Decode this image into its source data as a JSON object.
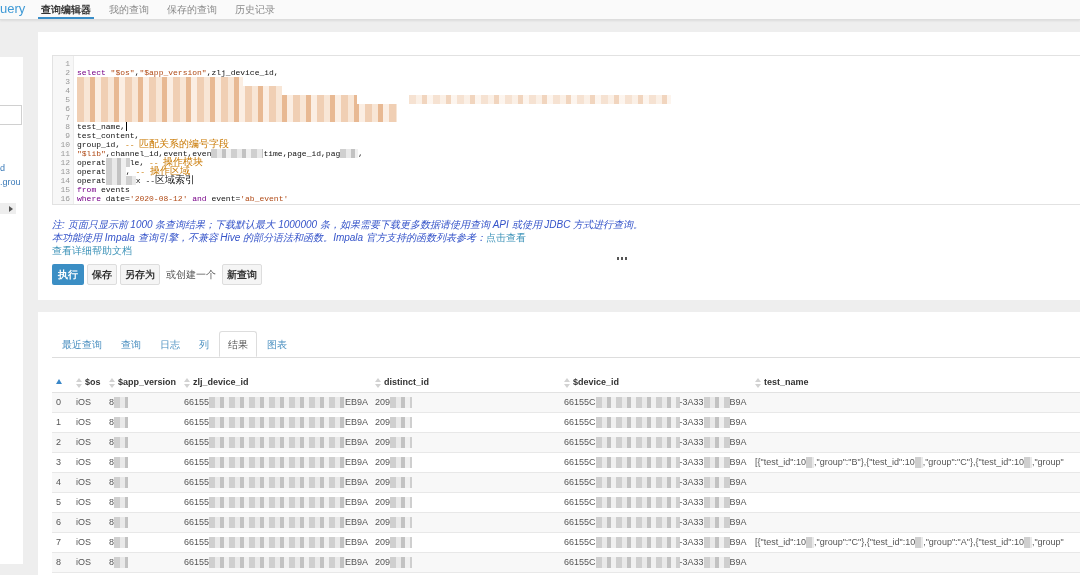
{
  "nav": {
    "logo": "uery",
    "tabs": [
      {
        "label": "查询编辑器",
        "selected": true
      },
      {
        "label": "我的查询",
        "selected": false
      },
      {
        "label": "保存的查询",
        "selected": false
      },
      {
        "label": "历史记录",
        "selected": false
      }
    ]
  },
  "sidebar": {
    "items": [
      {
        "label": "d"
      },
      {
        "label": ".grou"
      }
    ]
  },
  "editor": {
    "lines": [
      {
        "number": "1"
      },
      {
        "number": "2",
        "segments": [
          {
            "kind": "keyword",
            "text": "select"
          },
          {
            "kind": "string",
            "text": " \"$os\""
          },
          {
            "kind": "plain",
            "text": ","
          },
          {
            "kind": "string",
            "text": "\"$app_version\""
          },
          {
            "kind": "plain",
            "text": ",zlj_device_id,"
          }
        ]
      },
      {
        "number": "3",
        "segments": [
          {
            "kind": "redacted"
          }
        ]
      },
      {
        "number": "4",
        "segments": [
          {
            "kind": "redacted"
          }
        ]
      },
      {
        "number": "5",
        "segments": [
          {
            "kind": "redacted"
          },
          {
            "kind": "redacted"
          }
        ]
      },
      {
        "number": "6",
        "segments": [
          {
            "kind": "redacted"
          }
        ]
      },
      {
        "number": "7",
        "segments": [
          {
            "kind": "redacted"
          }
        ]
      },
      {
        "number": "8",
        "segments": [
          {
            "kind": "plain",
            "text": "test_name,"
          },
          {
            "kind": "cursor"
          }
        ]
      },
      {
        "number": "9",
        "segments": [
          {
            "kind": "plain",
            "text": "test_content,"
          }
        ]
      },
      {
        "number": "10",
        "segments": [
          {
            "kind": "plain",
            "text": "group_id, "
          },
          {
            "kind": "comment",
            "text": "-- 匹配关系的编号字段"
          }
        ]
      },
      {
        "number": "11",
        "segments": [
          {
            "kind": "string",
            "text": "\"$lib\""
          },
          {
            "kind": "plain",
            "text": ",channel_id,event,even"
          },
          {
            "kind": "redacted"
          },
          {
            "kind": "plain",
            "text": "time,page_id,pag"
          },
          {
            "kind": "redacted"
          },
          {
            "kind": "plain",
            "text": ","
          }
        ]
      },
      {
        "number": "12",
        "segments": [
          {
            "kind": "plain",
            "text": "operat"
          },
          {
            "kind": "redacted"
          },
          {
            "kind": "plain",
            "text": "le, "
          },
          {
            "kind": "comment",
            "text": "-- 操作模块"
          }
        ]
      },
      {
        "number": "13",
        "segments": [
          {
            "kind": "plain",
            "text": "operat"
          },
          {
            "kind": "redacted"
          },
          {
            "kind": "plain",
            "text": ", "
          },
          {
            "kind": "comment",
            "text": "-- 操作区域"
          }
        ]
      },
      {
        "number": "14",
        "segments": [
          {
            "kind": "plain",
            "text": "operat"
          },
          {
            "kind": "redacted"
          },
          {
            "kind": "plain",
            "text": "x --区域索引"
          }
        ]
      },
      {
        "number": "15",
        "segments": [
          {
            "kind": "keyword",
            "text": "from"
          },
          {
            "kind": "plain",
            "text": " events"
          }
        ]
      },
      {
        "number": "16",
        "segments": [
          {
            "kind": "keyword",
            "text": "where"
          },
          {
            "kind": "plain",
            "text": " date="
          },
          {
            "kind": "string",
            "text": "'2020-08-12'"
          },
          {
            "kind": "keyword",
            "text": " and"
          },
          {
            "kind": "plain",
            "text": " event="
          },
          {
            "kind": "string",
            "text": "'ab_event'"
          }
        ]
      }
    ]
  },
  "notes": [
    {
      "kind": "note",
      "text": "注: 页面只显示前 1000 条查询结果；下载默认最大 1000000 条，如果需要下载更多数据请使用查询 API 或使用 JDBC 方式进行查询。"
    },
    {
      "kind": "note",
      "text": "本功能使用 Impala 查询引擎，不兼容 Hive 的部分语法和函数。Impala 官方支持的函数列表参考：",
      "link": "点击查看"
    },
    {
      "kind": "link",
      "text": "查看详细帮助文档"
    }
  ],
  "actions": [
    {
      "kind": "primary",
      "label": "执行"
    },
    {
      "kind": "default",
      "label": "保存"
    },
    {
      "kind": "default",
      "label": "另存为"
    },
    {
      "kind": "text",
      "label": "或创建一个"
    },
    {
      "kind": "default",
      "label": "新查询"
    }
  ],
  "result_tabs": [
    {
      "label": "最近查询",
      "selected": false
    },
    {
      "label": "查询",
      "selected": false
    },
    {
      "label": "日志",
      "selected": false
    },
    {
      "label": "列",
      "selected": false
    },
    {
      "label": "结果",
      "selected": true
    },
    {
      "label": "图表",
      "selected": false
    }
  ],
  "table": {
    "columns": [
      {
        "sorted": true
      },
      {
        "label": "$os",
        "sorted": false
      },
      {
        "label": "$app_version",
        "sorted": false
      },
      {
        "label": "zlj_device_id",
        "sorted": false
      },
      {
        "label": "distinct_id",
        "sorted": false
      },
      {
        "label": "$device_id",
        "sorted": false
      },
      {
        "label": "test_name",
        "sorted": false
      }
    ],
    "rows": [
      {
        "index": "0",
        "os": "iOS",
        "app_version": [
          {
            "kind": "text",
            "text": "8"
          },
          {
            "kind": "redacted"
          }
        ],
        "zlj_device_id": [
          {
            "kind": "text",
            "text": "66155"
          },
          {
            "kind": "redacted"
          },
          {
            "kind": "text",
            "text": "EB9A"
          }
        ],
        "distinct_id": [
          {
            "kind": "text",
            "text": "209"
          },
          {
            "kind": "redacted"
          }
        ],
        "device_id": [
          {
            "kind": "text",
            "text": "66155C"
          },
          {
            "kind": "redacted"
          },
          {
            "kind": "text",
            "text": "-3A33"
          },
          {
            "kind": "redacted"
          },
          {
            "kind": "text",
            "text": "B9A"
          }
        ]
      },
      {
        "index": "1",
        "os": "iOS",
        "app_version": [
          {
            "kind": "text",
            "text": "8"
          },
          {
            "kind": "redacted"
          }
        ],
        "zlj_device_id": [
          {
            "kind": "text",
            "text": "66155"
          },
          {
            "kind": "redacted"
          },
          {
            "kind": "text",
            "text": "EB9A"
          }
        ],
        "distinct_id": [
          {
            "kind": "text",
            "text": "209"
          },
          {
            "kind": "redacted"
          }
        ],
        "device_id": [
          {
            "kind": "text",
            "text": "66155C"
          },
          {
            "kind": "redacted"
          },
          {
            "kind": "text",
            "text": "-3A33"
          },
          {
            "kind": "redacted"
          },
          {
            "kind": "text",
            "text": "B9A"
          }
        ]
      },
      {
        "index": "2",
        "os": "iOS",
        "app_version": [
          {
            "kind": "text",
            "text": "8"
          },
          {
            "kind": "redacted"
          }
        ],
        "zlj_device_id": [
          {
            "kind": "text",
            "text": "66155"
          },
          {
            "kind": "redacted"
          },
          {
            "kind": "text",
            "text": "EB9A"
          }
        ],
        "distinct_id": [
          {
            "kind": "text",
            "text": "209"
          },
          {
            "kind": "redacted"
          }
        ],
        "device_id": [
          {
            "kind": "text",
            "text": "66155C"
          },
          {
            "kind": "redacted"
          },
          {
            "kind": "text",
            "text": "-3A33"
          },
          {
            "kind": "redacted"
          },
          {
            "kind": "text",
            "text": "B9A"
          }
        ]
      },
      {
        "index": "3",
        "os": "iOS",
        "app_version": [
          {
            "kind": "text",
            "text": "8"
          },
          {
            "kind": "redacted"
          }
        ],
        "zlj_device_id": [
          {
            "kind": "text",
            "text": "66155"
          },
          {
            "kind": "redacted"
          },
          {
            "kind": "text",
            "text": "EB9A"
          }
        ],
        "distinct_id": [
          {
            "kind": "text",
            "text": "209"
          },
          {
            "kind": "redacted"
          }
        ],
        "device_id": [
          {
            "kind": "text",
            "text": "66155C"
          },
          {
            "kind": "redacted"
          },
          {
            "kind": "text",
            "text": "-3A33"
          },
          {
            "kind": "redacted"
          },
          {
            "kind": "text",
            "text": "B9A"
          }
        ],
        "test_name": [
          {
            "kind": "text",
            "text": "[{\"test_id\":10"
          },
          {
            "kind": "redacted"
          },
          {
            "kind": "text",
            "text": ",\"group\":\"B\"},{\"test_id\":10"
          },
          {
            "kind": "redacted"
          },
          {
            "kind": "text",
            "text": ",\"group\":\"C\"},{\"test_id\":10"
          },
          {
            "kind": "redacted"
          },
          {
            "kind": "text",
            "text": ",\"group\""
          }
        ]
      },
      {
        "index": "4",
        "os": "iOS",
        "app_version": [
          {
            "kind": "text",
            "text": "8"
          },
          {
            "kind": "redacted"
          }
        ],
        "zlj_device_id": [
          {
            "kind": "text",
            "text": "66155"
          },
          {
            "kind": "redacted"
          },
          {
            "kind": "text",
            "text": "EB9A"
          }
        ],
        "distinct_id": [
          {
            "kind": "text",
            "text": "209"
          },
          {
            "kind": "redacted"
          }
        ],
        "device_id": [
          {
            "kind": "text",
            "text": "66155C"
          },
          {
            "kind": "redacted"
          },
          {
            "kind": "text",
            "text": "-3A33"
          },
          {
            "kind": "redacted"
          },
          {
            "kind": "text",
            "text": "B9A"
          }
        ]
      },
      {
        "index": "5",
        "os": "iOS",
        "app_version": [
          {
            "kind": "text",
            "text": "8"
          },
          {
            "kind": "redacted"
          }
        ],
        "zlj_device_id": [
          {
            "kind": "text",
            "text": "66155"
          },
          {
            "kind": "redacted"
          },
          {
            "kind": "text",
            "text": "EB9A"
          }
        ],
        "distinct_id": [
          {
            "kind": "text",
            "text": "209"
          },
          {
            "kind": "redacted"
          }
        ],
        "device_id": [
          {
            "kind": "text",
            "text": "66155C"
          },
          {
            "kind": "redacted"
          },
          {
            "kind": "text",
            "text": "-3A33"
          },
          {
            "kind": "redacted"
          },
          {
            "kind": "text",
            "text": "B9A"
          }
        ]
      },
      {
        "index": "6",
        "os": "iOS",
        "app_version": [
          {
            "kind": "text",
            "text": "8"
          },
          {
            "kind": "redacted"
          }
        ],
        "zlj_device_id": [
          {
            "kind": "text",
            "text": "66155"
          },
          {
            "kind": "redacted"
          },
          {
            "kind": "text",
            "text": "EB9A"
          }
        ],
        "distinct_id": [
          {
            "kind": "text",
            "text": "209"
          },
          {
            "kind": "redacted"
          }
        ],
        "device_id": [
          {
            "kind": "text",
            "text": "66155C"
          },
          {
            "kind": "redacted"
          },
          {
            "kind": "text",
            "text": "-3A33"
          },
          {
            "kind": "redacted"
          },
          {
            "kind": "text",
            "text": "B9A"
          }
        ]
      },
      {
        "index": "7",
        "os": "iOS",
        "app_version": [
          {
            "kind": "text",
            "text": "8"
          },
          {
            "kind": "redacted"
          }
        ],
        "zlj_device_id": [
          {
            "kind": "text",
            "text": "66155"
          },
          {
            "kind": "redacted"
          },
          {
            "kind": "text",
            "text": "EB9A"
          }
        ],
        "distinct_id": [
          {
            "kind": "text",
            "text": "209"
          },
          {
            "kind": "redacted"
          }
        ],
        "device_id": [
          {
            "kind": "text",
            "text": "66155C"
          },
          {
            "kind": "redacted"
          },
          {
            "kind": "text",
            "text": "-3A33"
          },
          {
            "kind": "redacted"
          },
          {
            "kind": "text",
            "text": "B9A"
          }
        ],
        "test_name": [
          {
            "kind": "text",
            "text": "[{\"test_id\":10"
          },
          {
            "kind": "redacted"
          },
          {
            "kind": "text",
            "text": ",\"group\":\"C\"},{\"test_id\":10"
          },
          {
            "kind": "redacted"
          },
          {
            "kind": "text",
            "text": ",\"group\":\"A\"},{\"test_id\":10"
          },
          {
            "kind": "redacted"
          },
          {
            "kind": "text",
            "text": ",\"group\""
          }
        ]
      },
      {
        "index": "8",
        "os": "iOS",
        "app_version": [
          {
            "kind": "text",
            "text": "8"
          },
          {
            "kind": "redacted"
          }
        ],
        "zlj_device_id": [
          {
            "kind": "text",
            "text": "66155"
          },
          {
            "kind": "redacted"
          },
          {
            "kind": "text",
            "text": "EB9A"
          }
        ],
        "distinct_id": [
          {
            "kind": "text",
            "text": "209"
          },
          {
            "kind": "redacted"
          }
        ],
        "device_id": [
          {
            "kind": "text",
            "text": "66155C"
          },
          {
            "kind": "redacted"
          },
          {
            "kind": "text",
            "text": "-3A33"
          },
          {
            "kind": "redacted"
          },
          {
            "kind": "text",
            "text": "B9A"
          }
        ]
      }
    ]
  }
}
